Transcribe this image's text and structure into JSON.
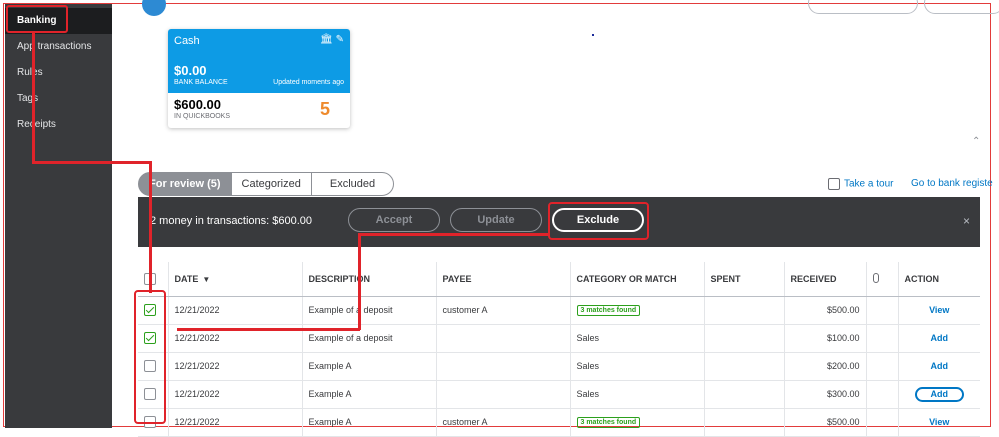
{
  "sidebar": {
    "items": [
      {
        "label": "Banking",
        "active": true
      },
      {
        "label": "App transactions"
      },
      {
        "label": "Rules"
      },
      {
        "label": "Tags"
      },
      {
        "label": "Receipts"
      }
    ]
  },
  "account_card": {
    "name": "Cash",
    "bank_balance": "$0.00",
    "bank_balance_label": "BANK BALANCE",
    "updated": "Updated moments ago",
    "qb_balance": "$600.00",
    "qb_label": "IN QUICKBOOKS",
    "pending_count": "5",
    "icons": [
      "bank-icon",
      "pencil-icon"
    ]
  },
  "tabs": [
    {
      "label": "For review (5)",
      "active": true
    },
    {
      "label": "Categorized"
    },
    {
      "label": "Excluded"
    }
  ],
  "links": {
    "tour": "Take a tour",
    "bank_register": "Go to bank registe"
  },
  "action_bar": {
    "summary": "2 money in transactions: $600.00",
    "accept": "Accept",
    "update": "Update",
    "exclude": "Exclude",
    "close": "×"
  },
  "table": {
    "headers": [
      "DATE",
      "DESCRIPTION",
      "PAYEE",
      "CATEGORY OR MATCH",
      "SPENT",
      "RECEIVED",
      "ACTION"
    ],
    "rows": [
      {
        "checked": true,
        "date": "12/21/2022",
        "description": "Example of a deposit",
        "payee": "customer A",
        "category": "3 matches found",
        "is_match": true,
        "spent": "",
        "received": "$500.00",
        "action": "View"
      },
      {
        "checked": true,
        "date": "12/21/2022",
        "description": "Example of a deposit",
        "payee": "",
        "category": "Sales",
        "is_match": false,
        "spent": "",
        "received": "$100.00",
        "action": "Add"
      },
      {
        "checked": false,
        "date": "12/21/2022",
        "description": "Example A",
        "payee": "",
        "category": "Sales",
        "is_match": false,
        "spent": "",
        "received": "$200.00",
        "action": "Add"
      },
      {
        "checked": false,
        "date": "12/21/2022",
        "description": "Example A",
        "payee": "",
        "category": "Sales",
        "is_match": false,
        "spent": "",
        "received": "$300.00",
        "action": "Add"
      },
      {
        "checked": false,
        "date": "12/21/2022",
        "description": "Example A",
        "payee": "customer A",
        "category": "3 matches found",
        "is_match": true,
        "spent": "",
        "received": "$500.00",
        "action": "View"
      }
    ]
  },
  "colors": {
    "sidebar": "#393a3d",
    "card_blue": "#0d9be5",
    "pending_orange": "#ee8a2d",
    "link_blue": "#0077c5",
    "match_green": "#2ca01c",
    "highlight_red": "#e0232a"
  }
}
